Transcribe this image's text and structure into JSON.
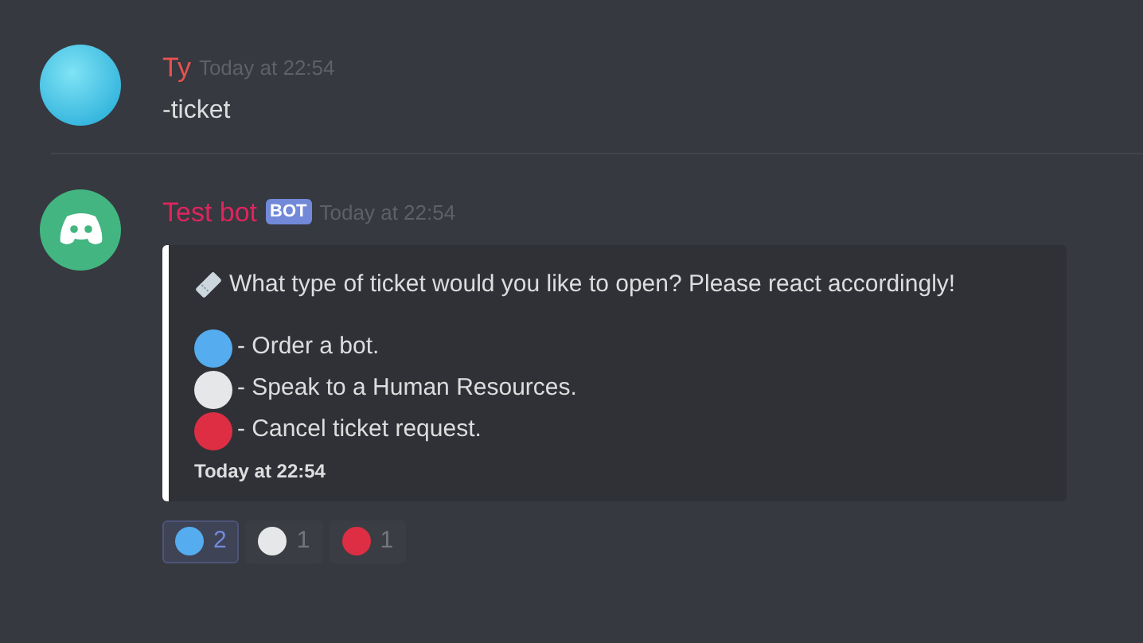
{
  "messages": [
    {
      "kind": "user",
      "author": "Ty",
      "color": "#e9524f",
      "timestamp": "Today at 22:54",
      "text": "-ticket"
    },
    {
      "kind": "bot",
      "author": "Test bot",
      "color": "#e0245e",
      "badge": "BOT",
      "timestamp": "Today at 22:54",
      "embed": {
        "description": "What type of ticket would you like to open? Please react accordingly!",
        "options": [
          {
            "color": "#55acee",
            "text": "- Order a bot."
          },
          {
            "color": "#e6e7e8",
            "text": "- Speak to a Human Resources."
          },
          {
            "color": "#dd2e44",
            "text": "- Cancel ticket request."
          }
        ],
        "footer": "Today at 22:54"
      },
      "reactions": [
        {
          "color": "#55acee",
          "count": "2",
          "selected": true
        },
        {
          "color": "#e6e7e8",
          "count": "1",
          "selected": false
        },
        {
          "color": "#dd2e44",
          "count": "1",
          "selected": false
        }
      ]
    }
  ]
}
